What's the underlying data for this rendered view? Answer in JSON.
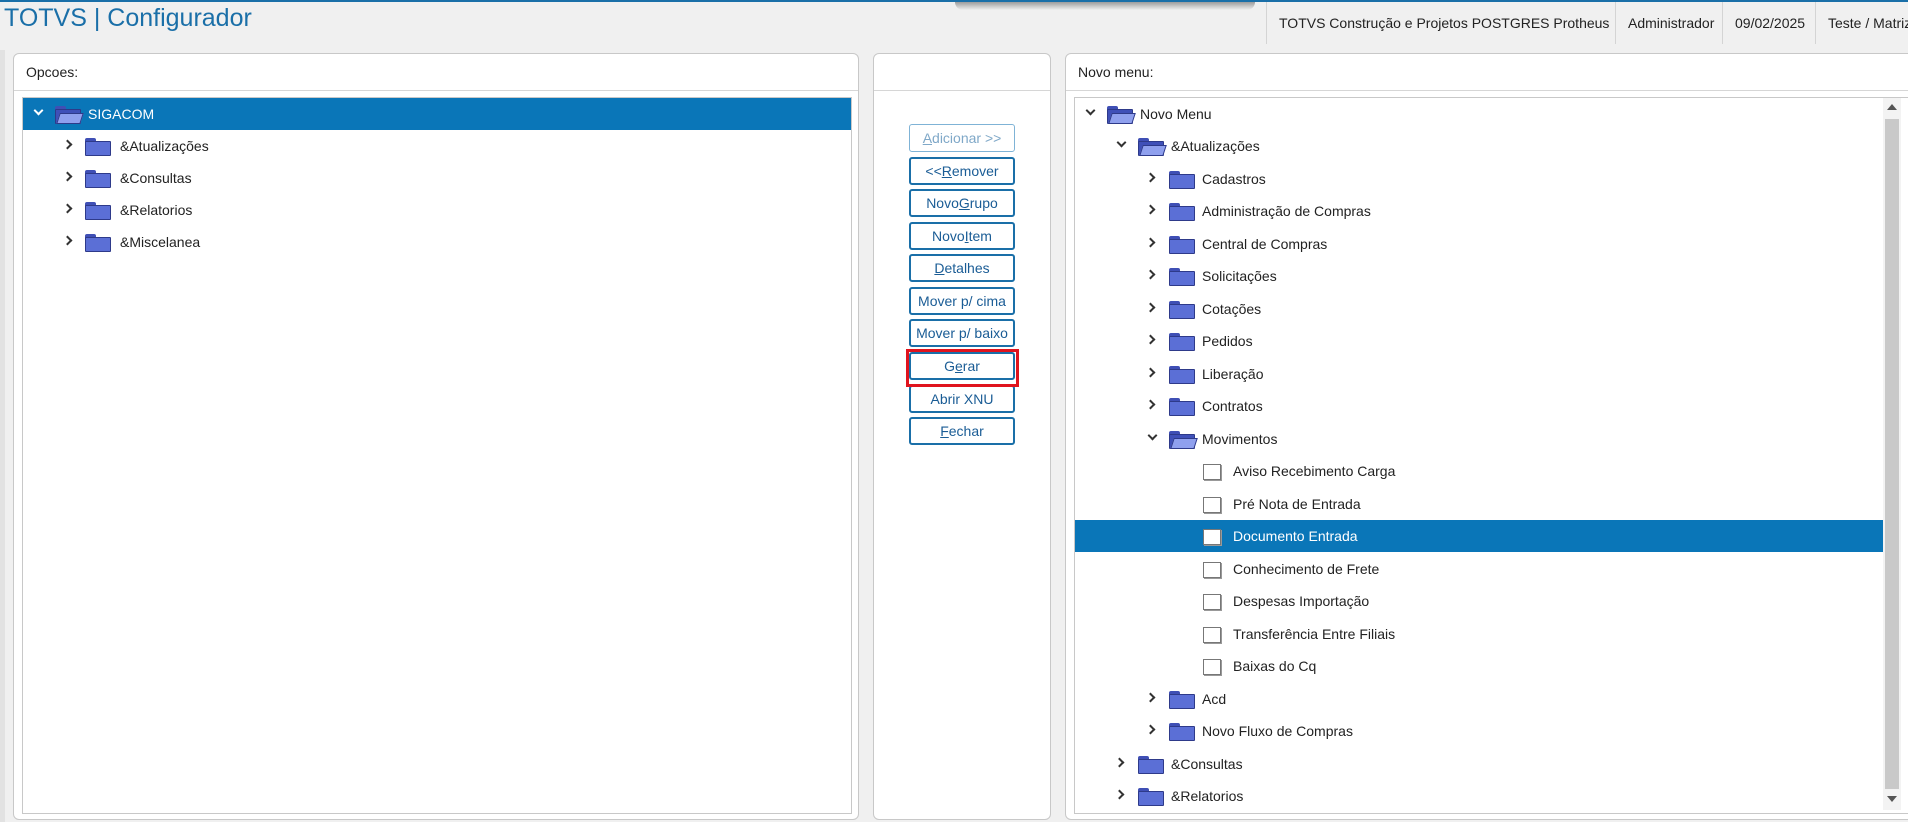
{
  "header": {
    "title": "TOTVS | Configurador",
    "company": "TOTVS Construção e Projetos POSTGRES Protheus",
    "user": "Administrador",
    "date": "09/02/2025",
    "branch": "Teste / Matriz"
  },
  "left_panel": {
    "title": "Opcoes:",
    "root": "SIGACOM",
    "items": [
      "&Atualizações",
      "&Consultas",
      "&Relatorios",
      "&Miscelanea"
    ]
  },
  "buttons": {
    "add": {
      "pre": "",
      "key": "A",
      "post": "dicionar >>"
    },
    "remove": {
      "pre": "<< ",
      "key": "R",
      "post": "emover"
    },
    "new_group": {
      "pre": "Novo ",
      "key": "G",
      "post": "rupo"
    },
    "new_item": {
      "pre": "Novo ",
      "key": "I",
      "post": "tem"
    },
    "details": {
      "pre": "",
      "key": "D",
      "post": "etalhes"
    },
    "move_up": {
      "pre": "Mover p/ cima",
      "key": "",
      "post": ""
    },
    "move_down": {
      "pre": "Mover p/ baixo",
      "key": "",
      "post": ""
    },
    "generate": {
      "pre": "G",
      "key": "e",
      "post": "rar"
    },
    "open_xnu": {
      "pre": "Abrir XNU",
      "key": "",
      "post": ""
    },
    "close": {
      "pre": "",
      "key": "F",
      "post": "echar"
    }
  },
  "right_panel": {
    "title": "Novo menu:",
    "root": "Novo Menu",
    "atualizacoes": "&Atualizações",
    "groups": [
      "Cadastros",
      "Administração de Compras",
      "Central de Compras",
      "Solicitações",
      "Cotações",
      "Pedidos",
      "Liberação",
      "Contratos"
    ],
    "movimentos": "Movimentos",
    "movimentos_items": [
      "Aviso Recebimento Carga",
      "Pré Nota de Entrada",
      "Documento Entrada",
      "Conhecimento de Frete",
      "Despesas Importação",
      "Transferência Entre Filiais",
      "Baixas do Cq"
    ],
    "selected_item": "Documento Entrada",
    "more_groups": [
      "Acd",
      "Novo Fluxo de Compras"
    ],
    "top_level": [
      "&Consultas",
      "&Relatorios"
    ]
  },
  "colors": {
    "accent": "#1a6fa8",
    "selection": "#0a76b8",
    "highlight": "#e0141e"
  },
  "icons": {
    "folder": "folder-icon",
    "folder_open": "folder-open-icon",
    "document": "document-icon",
    "expand": "chevron-right-icon",
    "collapse": "chevron-down-icon"
  }
}
